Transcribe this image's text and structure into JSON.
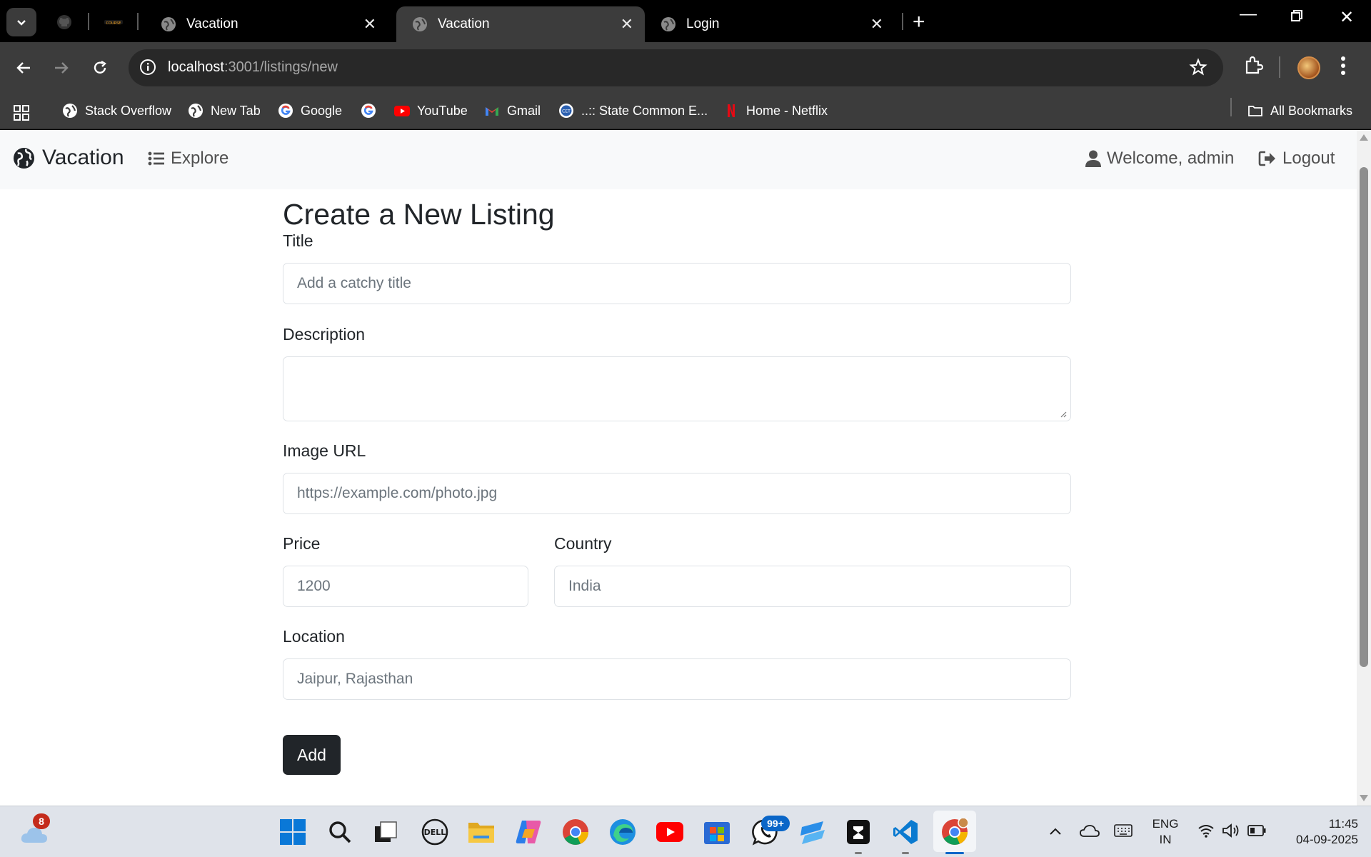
{
  "browser": {
    "tabs": [
      {
        "title": "Vacation",
        "active": false
      },
      {
        "title": "Vacation",
        "active": true
      },
      {
        "title": "Login",
        "active": false
      }
    ],
    "url_host": "localhost",
    "url_path": ":3001/listings/new",
    "bookmarks": [
      {
        "label": "Stack Overflow",
        "icon": "globe-icon"
      },
      {
        "label": "New Tab",
        "icon": "globe-icon"
      },
      {
        "label": "Google",
        "icon": "google-icon"
      },
      {
        "label": "YouTube",
        "icon": "youtube-icon"
      },
      {
        "label": "Gmail",
        "icon": "gmail-icon"
      },
      {
        "label": "..:: State Common E...",
        "icon": "cet-icon"
      },
      {
        "label": "Home - Netflix",
        "icon": "netflix-icon"
      }
    ],
    "all_bookmarks": "All Bookmarks"
  },
  "app": {
    "brand": "Vacation",
    "nav_explore": "Explore",
    "welcome": "Welcome, admin",
    "logout": "Logout"
  },
  "form": {
    "heading": "Create a New Listing",
    "title_label": "Title",
    "title_placeholder": "Add a catchy title",
    "description_label": "Description",
    "description_value": "",
    "image_label": "Image URL",
    "image_placeholder": "https://example.com/photo.jpg",
    "price_label": "Price",
    "price_placeholder": "1200",
    "country_label": "Country",
    "country_placeholder": "India",
    "location_label": "Location",
    "location_placeholder": "Jaipur, Rajasthan",
    "submit": "Add"
  },
  "taskbar": {
    "weather_badge": "8",
    "whatsapp_badge": "99+",
    "lang_line1": "ENG",
    "lang_line2": "IN",
    "time": "11:45",
    "date": "04-09-2025"
  },
  "colors": {
    "accent_dark": "#212529",
    "navbar_bg": "#f8f9fa",
    "chrome_toolbar": "#3c3c3c"
  }
}
